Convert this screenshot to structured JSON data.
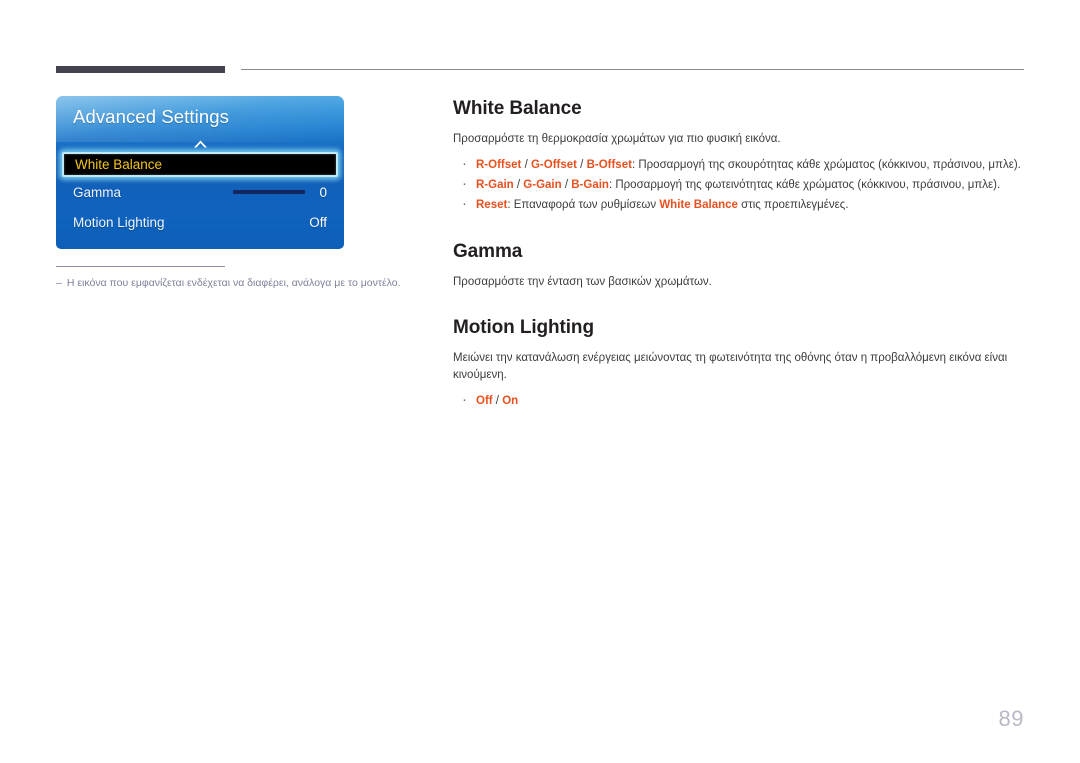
{
  "page": {
    "number": "89"
  },
  "osd": {
    "title": "Advanced Settings",
    "scroll_up_icon": "chevron-up-icon",
    "rows": [
      {
        "label": "White Balance",
        "value": "",
        "selected": true
      },
      {
        "label": "Gamma",
        "value": "0",
        "selected": false
      },
      {
        "label": "Motion Lighting",
        "value": "Off",
        "selected": false
      }
    ]
  },
  "figure_note": {
    "dash": "–",
    "text": "Η εικόνα που εμφανίζεται ενδέχεται να διαφέρει, ανάλογα με το μοντέλο."
  },
  "sections": {
    "white_balance": {
      "title": "White Balance",
      "desc": "Προσαρμόστε τη θερμοκρασία χρωμάτων για πιο φυσική εικόνα.",
      "bullets": [
        {
          "kw1": "R-Offset",
          "kw2": "G-Offset",
          "kw3": "B-Offset",
          "rest": ": Προσαρμογή της σκουρότητας κάθε χρώματος (κόκκινου, πράσινου, μπλε)."
        },
        {
          "kw1": "R-Gain",
          "kw2": "G-Gain",
          "kw3": "B-Gain",
          "rest": ": Προσαρμογή της φωτεινότητας κάθε χρώματος (κόκκινου, πράσινου, μπλε)."
        }
      ],
      "reset_bullet": {
        "kw1": "Reset",
        "mid": ": Επαναφορά των ρυθμίσεων ",
        "kw2": "White Balance",
        "tail": " στις προεπιλεγμένες."
      }
    },
    "gamma": {
      "title": "Gamma",
      "desc": "Προσαρμόστε την ένταση των βασικών χρωμάτων."
    },
    "motion_lighting": {
      "title": "Motion Lighting",
      "desc": "Μειώνει την κατανάλωση ενέργειας μειώνοντας τη φωτεινότητα της οθόνης όταν η προβαλλόμενη εικόνα είναι κινούμενη.",
      "options": {
        "opt1": "Off",
        "opt2": "On"
      }
    }
  },
  "colors": {
    "accent_orange": "#e8501e",
    "osd_blue": "#1560b8",
    "selected_text": "#f5c518",
    "heading": "#231f20",
    "body": "#3c3c3c",
    "note": "#7d819a",
    "page_number": "#b9b8c6"
  }
}
